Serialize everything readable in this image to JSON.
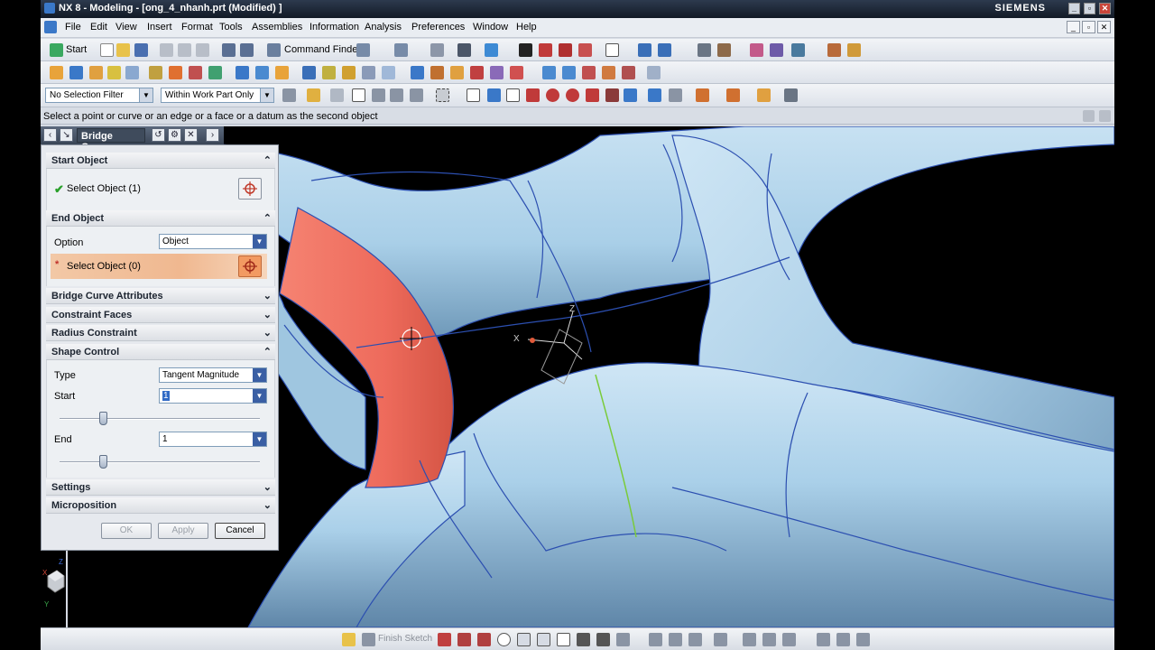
{
  "window": {
    "title": "NX 8 - Modeling - [ong_4_nhanh.prt (Modified) ]",
    "brand": "SIEMENS",
    "controls": [
      "_",
      "▫",
      "✕"
    ]
  },
  "menu": {
    "items": [
      "File",
      "Edit",
      "View",
      "Insert",
      "Format",
      "Tools",
      "Assemblies",
      "Information",
      "Analysis",
      "Preferences",
      "Window",
      "Help"
    ]
  },
  "toolbar": {
    "start_label": "Start",
    "command_finder_label": "Command Finder"
  },
  "filters": {
    "selection_filter": "No Selection Filter",
    "scope": "Within Work Part Only"
  },
  "cue_line": "Select a point or curve or an edge or a face or a datum as the second object",
  "dialog": {
    "title": "Bridge Curve",
    "sections": {
      "start_object": "Start Object",
      "end_object": "End Object",
      "bridge_curve_attributes": "Bridge Curve Attributes",
      "constraint_faces": "Constraint Faces",
      "radius_constraint": "Radius Constraint",
      "shape_control": "Shape Control",
      "settings": "Settings",
      "microposition": "Microposition"
    },
    "start_select": "Select Object (1)",
    "end_option_label": "Option",
    "end_option_value": "Object",
    "end_select": "Select Object (0)",
    "type_label": "Type",
    "type_value": "Tangent Magnitude",
    "start_label": "Start",
    "start_value": "1",
    "start_slider_fraction": 0.22,
    "end_label": "End",
    "end_value": "1",
    "end_slider_fraction": 0.22,
    "buttons": {
      "ok": "OK",
      "apply": "Apply",
      "cancel": "Cancel"
    }
  },
  "statusbar": {
    "finish_sketch": "Finish Sketch"
  },
  "colors": {
    "part_surface": "#a9cfe8",
    "selected_face": "#ee6b5c",
    "edge_lines": "#2c4fb0",
    "dialog_header": "#3f4b5c",
    "highlight_row": "#f0b890"
  },
  "viewport": {
    "triad_axes": [
      "X",
      "Y",
      "Z"
    ]
  }
}
